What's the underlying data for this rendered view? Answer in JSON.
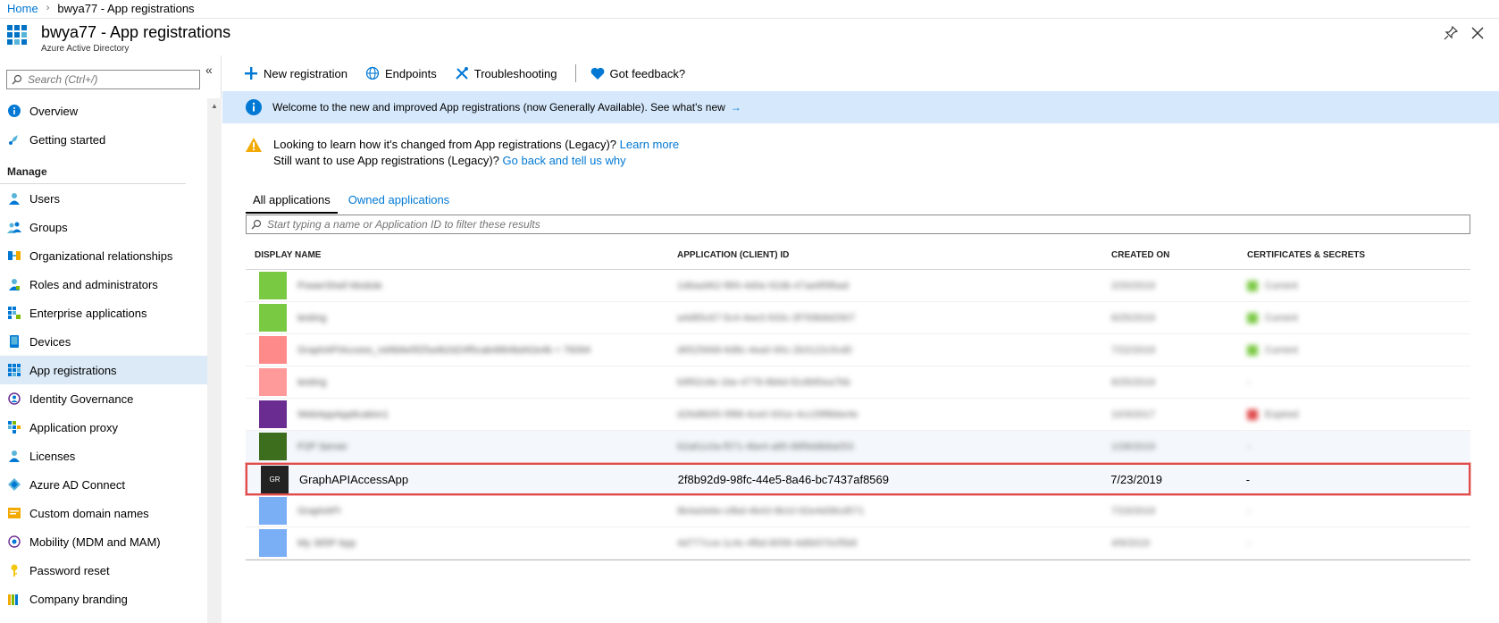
{
  "breadcrumb": {
    "home": "Home",
    "current": "bwya77 - App registrations"
  },
  "header": {
    "title": "bwya77 - App registrations",
    "subtitle": "Azure Active Directory"
  },
  "sidebar": {
    "search_placeholder": "Search (Ctrl+/)",
    "items_top": [
      {
        "label": "Overview",
        "icon": "info-icon"
      },
      {
        "label": "Getting started",
        "icon": "rocket-icon"
      }
    ],
    "section_manage": "Manage",
    "items_manage": [
      {
        "label": "Users",
        "icon": "user-icon"
      },
      {
        "label": "Groups",
        "icon": "group-icon"
      },
      {
        "label": "Organizational relationships",
        "icon": "org-relationships-icon"
      },
      {
        "label": "Roles and administrators",
        "icon": "roles-icon"
      },
      {
        "label": "Enterprise applications",
        "icon": "enterprise-apps-icon"
      },
      {
        "label": "Devices",
        "icon": "device-icon"
      },
      {
        "label": "App registrations",
        "icon": "app-registrations-icon"
      },
      {
        "label": "Identity Governance",
        "icon": "identity-governance-icon"
      },
      {
        "label": "Application proxy",
        "icon": "app-proxy-icon"
      },
      {
        "label": "Licenses",
        "icon": "license-icon"
      },
      {
        "label": "Azure AD Connect",
        "icon": "ad-connect-icon"
      },
      {
        "label": "Custom domain names",
        "icon": "domain-icon"
      },
      {
        "label": "Mobility (MDM and MAM)",
        "icon": "mobility-icon"
      },
      {
        "label": "Password reset",
        "icon": "key-icon"
      },
      {
        "label": "Company branding",
        "icon": "branding-icon"
      }
    ]
  },
  "toolbar": {
    "new_registration": "New registration",
    "endpoints": "Endpoints",
    "troubleshooting": "Troubleshooting",
    "feedback": "Got feedback?"
  },
  "banner": {
    "text": "Welcome to the new and improved App registrations (now Generally Available). See what's new"
  },
  "legacy": {
    "line1": "Looking to learn how it's changed from App registrations (Legacy)?",
    "line1_link": "Learn more",
    "line2": "Still want to use App registrations (Legacy)?",
    "line2_link": "Go back and tell us why"
  },
  "tabs": {
    "all": "All applications",
    "owned": "Owned applications"
  },
  "filter_placeholder": "Start typing a name or Application ID to filter these results",
  "table": {
    "columns": [
      "DISPLAY NAME",
      "APPLICATION (CLIENT) ID",
      "CREATED ON",
      "CERTIFICATES & SECRETS"
    ],
    "blurred_rows": [
      {
        "name": "PowerShell Module",
        "id": "1d6aa962-f8f4-4d0e-92db-47ae8f9fbad",
        "date": "2/20/2019",
        "status": "Current",
        "color": "#7ac943",
        "status_color": "#7ac943"
      },
      {
        "name": "testing",
        "id": "a4d85c67-5c4-4ee3-933c-3f769b8d2907",
        "date": "6/25/2019",
        "status": "Current",
        "color": "#7ac943",
        "status_color": "#7ac943"
      },
      {
        "name": "GraphAPIAccess_nd4b6e5f25a4b2d24f5cab4864bd42e4b + 76094",
        "id": "d6525668-6d8c-4ea0-90c-2b3122c5cd0",
        "date": "7/22/2019",
        "status": "Current",
        "color": "#ff8a8a",
        "status_color": "#7ac943"
      },
      {
        "name": "testing",
        "id": "b9f92c6e-1be-4778-8b6d-f2c8bf0ea7bb",
        "date": "6/25/2019",
        "status": "-",
        "color": "#ff9a9a",
        "status_color": ""
      },
      {
        "name": "WebAppApplication1",
        "id": "d26d8b55-5f88-4ce0-931e-4cc29f8bbe4e",
        "date": "10/3/2017",
        "status": "Expired",
        "color": "#6b2c91",
        "status_color": "#e04b4b"
      },
      {
        "name": "P2P Server",
        "id": "62a61c0a-f571-4be4-a85-88f9ddb8a053",
        "date": "1/28/2019",
        "status": "-",
        "color": "#3d6e1e",
        "status_color": ""
      }
    ],
    "highlight_row": {
      "avatar": "GR",
      "name": "GraphAPIAccessApp",
      "id": "2f8b92d9-98fc-44e5-8a46-bc7437af8569",
      "date": "7/23/2019",
      "status": "-"
    },
    "blurred_rows_after": [
      {
        "name": "GraphAPI",
        "id": "8b4a0e6e-c8bd-4b43-9b10-92e4d38cd571",
        "date": "7/23/2019",
        "status": "-",
        "color": "#7aaef5"
      },
      {
        "name": "My 365P App",
        "id": "4d777cce-1c4c-4fbd-8058-4d6b570cf5b8",
        "date": "4/9/2019",
        "status": "-",
        "color": "#7aaef5"
      }
    ]
  },
  "colors": {
    "accent": "#0078d4",
    "banner_bg": "#d6e8fb",
    "active_nav": "#dceaf7",
    "highlight_border": "#e04b4b"
  }
}
